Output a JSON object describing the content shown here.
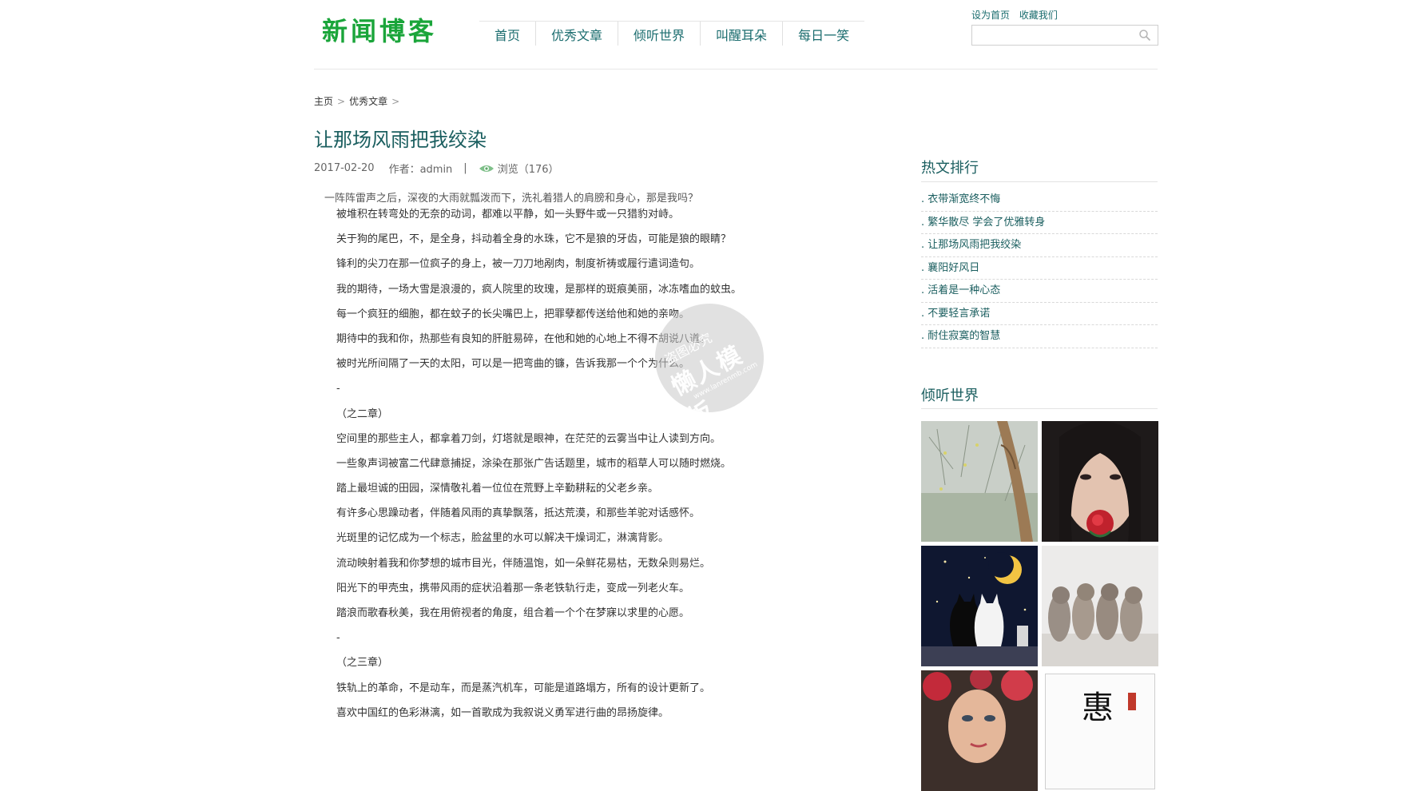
{
  "header": {
    "logo": "新闻博客",
    "nav": [
      "首页",
      "优秀文章",
      "倾听世界",
      "叫醒耳朵",
      "每日一笑"
    ],
    "top_links": [
      "设为首页",
      "收藏我们"
    ],
    "search_placeholder": ""
  },
  "breadcrumb": [
    "主页",
    "优秀文章"
  ],
  "article": {
    "title": "让那场风雨把我绞染",
    "date": "2017-02-20",
    "author": "作者：admin",
    "views": "浏览（176）",
    "lead": "一阵阵雷声之后，深夜的大雨就瓢泼而下，洗礼着猎人的肩膀和身心，那是我吗？",
    "paragraphs": [
      "被堆积在转弯处的无奈的动词，都难以平静，如一头野牛或一只猎豹对峙。",
      "关于狗的尾巴，不，是全身，抖动着全身的水珠，它不是狼的牙齿，可能是狼的眼睛？",
      "锋利的尖刀在那一位疯子的身上，被一刀刀地剐肉，制度祈祷或履行遣词造句。",
      "我的期待，一场大雪是浪漫的，疯人院里的玫瑰，是那样的斑痕美丽，冰冻嗜血的蚊虫。",
      "每一个疯狂的细胞，都在蚊子的长尖嘴巴上，把罪孽都传送给他和她的亲吻。",
      "期待中的我和你，热那些有良知的肝脏易碎，在他和她的心地上不得不胡说八道。",
      "被时光所间隔了一天的太阳，可以是一把弯曲的镰，告诉我那一个个为什么。",
      "-",
      "（之二章）",
      "空间里的那些主人，都拿着刀剑，灯塔就是眼神，在茫茫的云雾当中让人读到方向。",
      "一些象声词被富二代肆意捕捉，涂染在那张广告话题里，城市的稻草人可以随时燃烧。",
      "踏上最坦诚的田园，深情敬礼着一位位在荒野上辛勤耕耘的父老乡亲。",
      "有许多心思躁动者，伴随着风雨的真挚飘落，抵达荒漠，和那些羊驼对话感怀。",
      "光斑里的记忆成为一个标志，脸盆里的水可以解决干燥词汇，淋漓背影。",
      "流动映射着我和你梦想的城市目光，伴随温饱，如一朵鲜花易枯，无数朵则易烂。",
      "阳光下的甲壳虫，携带风雨的症状沿着那一条老铁轨行走，变成一列老火车。",
      "踏浪而歌春秋美，我在用俯视者的角度，组合着一个个在梦寐以求里的心愿。",
      "-",
      "（之三章）",
      "铁轨上的革命，不是动车，而是蒸汽机车，可能是道路塌方，所有的设计更新了。",
      "喜欢中国红的色彩淋漓，如一首歌成为我叙说义勇军进行曲的昂扬旋律。"
    ]
  },
  "watermark": {
    "line1": "盗图必究",
    "line2": "懒人模板",
    "line3": "www.lanrenmb.com"
  },
  "sidebar": {
    "hot_title": "热文排行",
    "hot_items": [
      ". 衣带渐宽终不悔",
      ". 繁华散尽 学会了优雅转身",
      ". 让那场风雨把我绞染",
      ". 襄阳好风日",
      ". 活着是一种心态",
      ". 不要轻言承诺",
      ". 耐住寂寞的智慧"
    ],
    "listen_title": "倾听世界",
    "calligraphy_char": "惠"
  },
  "colors": {
    "logo_green": "#1aa53a",
    "teal_text": "#1a5e5f"
  }
}
